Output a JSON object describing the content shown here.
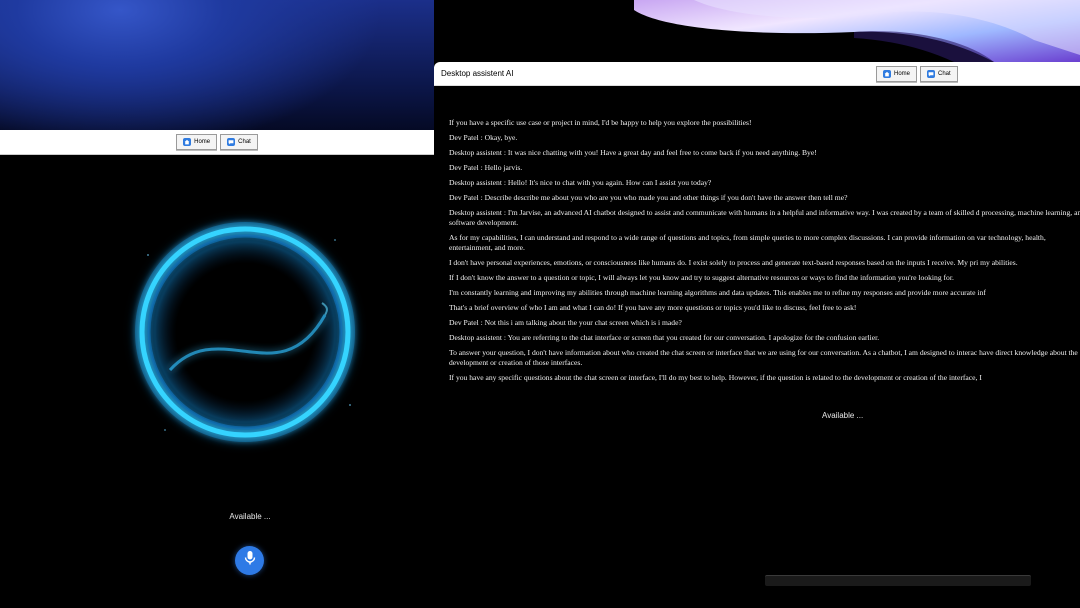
{
  "left_window": {
    "toolbar": {
      "home_label": "Home",
      "chat_label": "Chat"
    },
    "status_text": "Available ...",
    "icons": {
      "home": "home-icon",
      "chat": "chat-icon",
      "mic": "microphone-icon"
    },
    "colors": {
      "orb": "#2fc8ff",
      "mic_button": "#2e7ae6"
    }
  },
  "right_window": {
    "title": "Desktop assistent AI",
    "toolbar": {
      "home_label": "Home",
      "chat_label": "Chat"
    },
    "messages": [
      "If you have a specific use case or project in mind, I'd be happy to help you explore the possibilities!",
      "Dev Patel : Okay, bye.",
      "Desktop assistent : It was nice chatting with you! Have a great day and feel free to come back if you need anything. Bye!",
      "Dev Patel : Hello jarvis.",
      "Desktop assistent : Hello! It's nice to chat with you again. How can I assist you today?",
      "Dev Patel : Describe describe me about you who are you who made you and other things if you don't have the answer then tell me?",
      "Desktop assistent : I'm Jarvise, an advanced AI chatbot designed to assist and communicate with humans in a helpful and informative way. I was created by a team of skilled d processing, machine learning, and software development.",
      "As for my capabilities, I can understand and respond to a wide range of questions and topics, from simple queries to more complex discussions. I can provide information on var technology, health, entertainment, and more.",
      "I don't have personal experiences, emotions, or consciousness like humans do. I exist solely to process and generate text-based responses based on the inputs I receive. My pri my abilities.",
      "If I don't know the answer to a question or topic, I will always let you know and try to suggest alternative resources or ways to find the information you're looking for.",
      "I'm constantly learning and improving my abilities through machine learning algorithms and data updates. This enables me to refine my responses and provide more accurate inf",
      "That's a brief overview of who I am and what I can do! If you have any more questions or topics you'd like to discuss, feel free to ask!",
      "Dev Patel : Not this i am talking about the your chat screen which is i made?",
      "Desktop assistent : You are referring to the chat interface or screen that you created for our conversation. I apologize for the confusion earlier.",
      "To answer your question, I don't have information about who created the chat screen or interface that we are using for our conversation. As a chatbot, I am designed to interac have direct knowledge about the development or creation of those interfaces.",
      "If you have any specific questions about the chat screen or interface, I'll do my best to help. However, if the question is related to the development or creation of the interface, I"
    ],
    "status_text": "Available ..."
  }
}
